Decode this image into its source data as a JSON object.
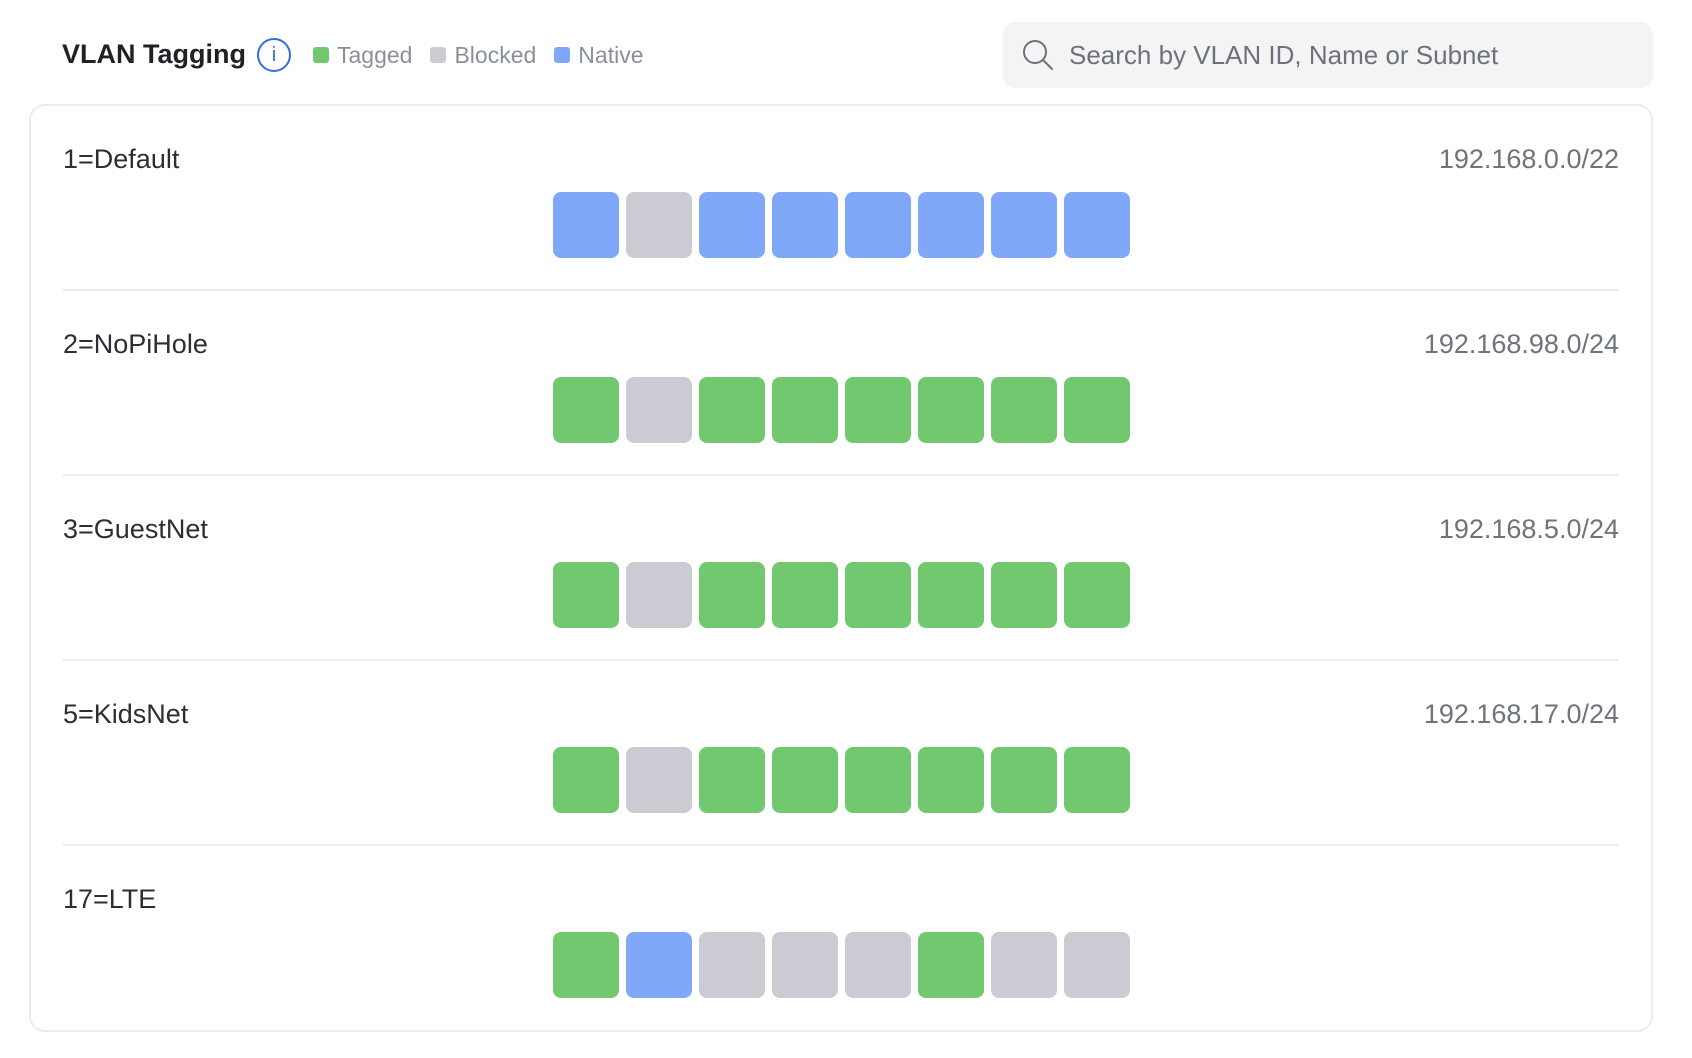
{
  "header": {
    "title": "VLAN Tagging",
    "info_icon": "info-icon",
    "legend": [
      {
        "label": "Tagged",
        "state": "tagged"
      },
      {
        "label": "Blocked",
        "state": "blocked"
      },
      {
        "label": "Native",
        "state": "native"
      }
    ]
  },
  "search": {
    "placeholder": "Search by VLAN ID, Name or Subnet",
    "value": "",
    "icon": "search-icon"
  },
  "colors": {
    "tagged": "#72c86e",
    "blocked": "#cbcbd3",
    "native": "#80a8f8",
    "accent": "#2f6fe0"
  },
  "vlans": [
    {
      "name": "1=Default",
      "subnet": "192.168.0.0/22",
      "ports": [
        "native",
        "blocked",
        "native",
        "native",
        "native",
        "native",
        "native",
        "native"
      ]
    },
    {
      "name": "2=NoPiHole",
      "subnet": "192.168.98.0/24",
      "ports": [
        "tagged",
        "blocked",
        "tagged",
        "tagged",
        "tagged",
        "tagged",
        "tagged",
        "tagged"
      ]
    },
    {
      "name": "3=GuestNet",
      "subnet": "192.168.5.0/24",
      "ports": [
        "tagged",
        "blocked",
        "tagged",
        "tagged",
        "tagged",
        "tagged",
        "tagged",
        "tagged"
      ]
    },
    {
      "name": "5=KidsNet",
      "subnet": "192.168.17.0/24",
      "ports": [
        "tagged",
        "blocked",
        "tagged",
        "tagged",
        "tagged",
        "tagged",
        "tagged",
        "tagged"
      ]
    },
    {
      "name": "17=LTE",
      "subnet": "",
      "ports": [
        "tagged",
        "native",
        "blocked",
        "blocked",
        "blocked",
        "tagged",
        "blocked",
        "blocked"
      ]
    }
  ]
}
